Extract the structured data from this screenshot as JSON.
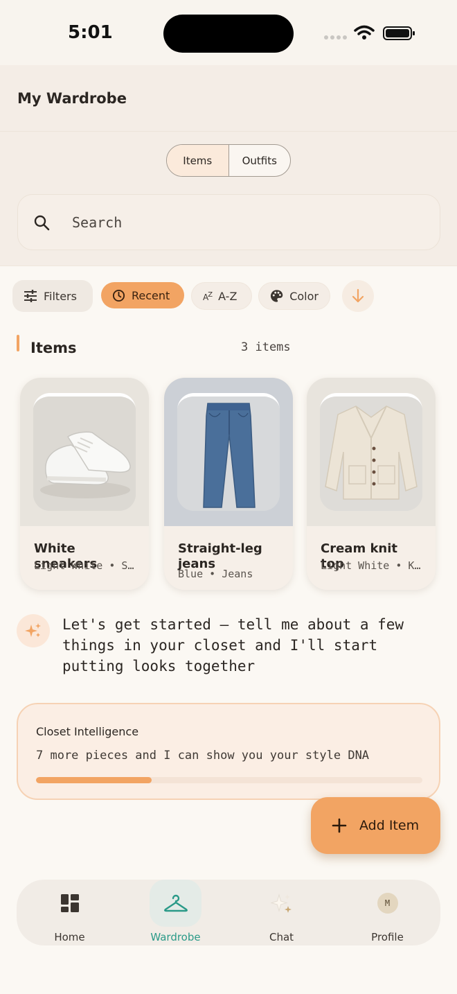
{
  "status_bar": {
    "time": "5:01",
    "icons": [
      "signal-dots-icon",
      "wifi-icon",
      "battery-icon"
    ]
  },
  "header": {
    "title": "My Wardrobe"
  },
  "view_toggle": {
    "options": [
      "Items",
      "Outfits"
    ],
    "selected": "Items"
  },
  "search": {
    "placeholder": "Search",
    "value": ""
  },
  "filters": {
    "filters_label": "Filters",
    "sort_options": [
      {
        "label": "Recent",
        "icon": "clock-icon",
        "active": true
      },
      {
        "label": "A-Z",
        "icon": "sort-alpha-icon",
        "active": false
      },
      {
        "label": "Color",
        "icon": "palette-icon",
        "active": false
      }
    ],
    "sort_direction_icon": "arrow-down-icon"
  },
  "items_section": {
    "title": "Items",
    "count": "3 items",
    "items": [
      {
        "name": "White sneakers",
        "meta": "Light White • Sneakers",
        "image": "white-sneakers-photo"
      },
      {
        "name": "Straight-leg jeans",
        "meta": "Blue • Jeans",
        "image": "blue-jeans-photo"
      },
      {
        "name": "Cream knit top",
        "meta": "Light White • Knitwear",
        "image": "cream-cardigan-photo"
      }
    ]
  },
  "assistant": {
    "icon": "sparkle-icon",
    "message": "Let's get started — tell me about a few things in your closet and I'll start putting looks together"
  },
  "closet_intelligence": {
    "title": "Closet Intelligence",
    "text": "7 more pieces and I can show you your style DNA",
    "progress": 0.3
  },
  "fab": {
    "label": "Add Item",
    "icon": "plus-icon"
  },
  "bottom_nav": {
    "items": [
      {
        "label": "Home",
        "icon": "home-grid-icon",
        "active": false
      },
      {
        "label": "Wardrobe",
        "icon": "hanger-icon",
        "active": true
      },
      {
        "label": "Chat",
        "icon": "sparkles-icon",
        "active": false
      },
      {
        "label": "Profile",
        "icon": "avatar-icon",
        "active": false,
        "avatar_initial": "M"
      }
    ]
  },
  "colors": {
    "accent": "#f2a463",
    "active_nav": "#2a9a88",
    "background": "#fbf8f3"
  }
}
